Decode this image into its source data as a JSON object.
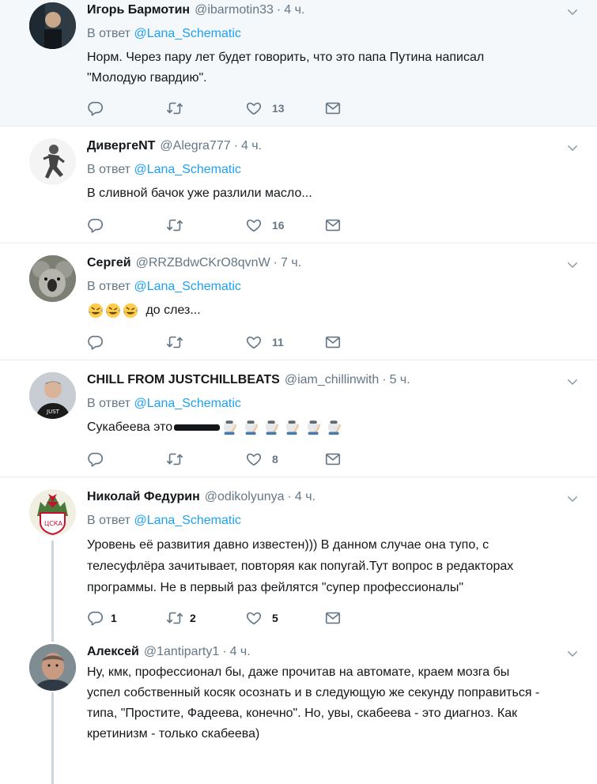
{
  "tweets": [
    {
      "name": "Игорь Бармотин",
      "handle": "@ibarmotin33",
      "time": "4 ч.",
      "reply_prefix": "В ответ",
      "reply_to": "@Lana_Schematic",
      "lines": [
        "Норм. Через пару лет будет говорить, что это папа Путина написал",
        "\"Молодую гвардию\"."
      ],
      "replies": "",
      "retweets": "",
      "likes": "13"
    },
    {
      "name": "ДивергеNT",
      "handle": "@Alegra777",
      "time": "4 ч.",
      "reply_prefix": "В ответ",
      "reply_to": "@Lana_Schematic",
      "lines": [
        "В сливной бачок уже разлили масло..."
      ],
      "replies": "",
      "retweets": "",
      "likes": "16"
    },
    {
      "name": "Сергей",
      "handle": "@RRZBdwCKrO8qvnW",
      "time": "7 ч.",
      "reply_prefix": "В ответ",
      "reply_to": "@Lana_Schematic",
      "text_after_emoji": "до слез...",
      "replies": "",
      "retweets": "",
      "likes": "11"
    },
    {
      "name": "CHILL FROM JUSTCHILLBEATS",
      "handle": "@iam_chillinwith",
      "time": "5 ч.",
      "reply_prefix": "В ответ",
      "reply_to": "@Lana_Schematic",
      "text_before": "Сукабеева это",
      "replies": "",
      "retweets": "",
      "likes": "8"
    },
    {
      "name": "Николай Федурин",
      "handle": "@odikolyunya",
      "time": "4 ч.",
      "reply_prefix": "В ответ",
      "reply_to": "@Lana_Schematic",
      "lines": [
        "Уровень её развития давно известен))) В данном случае она тупо, с",
        "телесуфлёра зачитывает, повторяя как попугай.Тут вопрос в редакторах",
        "программы. Не в первый раз фейлятся \"супер профессионалы\""
      ],
      "replies": "1",
      "retweets": "2",
      "likes": "5"
    },
    {
      "name": "Алексей",
      "handle": "@1antiparty1",
      "time": "4 ч.",
      "lines": [
        "Ну, кмк, профессионал бы, даже прочитав на автомате, краем мозга бы",
        "успел собственный косяк осознать и в следующую же секунду поправиться -",
        "типа, \"Простите, Фадеева, конечно\". Но, увы, скабеева - это диагноз. Как",
        "кретинизм - только скабеева)"
      ]
    }
  ],
  "colors": {
    "link": "#1da1f2",
    "secondary": "#657786",
    "divider": "#e6ecf0",
    "highlight_bg": "#f5f8fa"
  },
  "icons": [
    "reply-icon",
    "retweet-icon",
    "like-icon",
    "direct-message-icon",
    "caret-down-icon"
  ]
}
